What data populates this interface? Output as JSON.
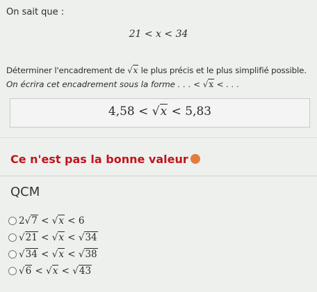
{
  "intro": "On sait que :",
  "given": "21 < x < 34",
  "question": {
    "before": "Déterminer l'encadrement de ",
    "sqrt_var": "x",
    "after": " le plus précis et le plus simplifié possible."
  },
  "hint": {
    "before": "On écrira cet encadrement sous la forme . . . < ",
    "sqrt_var": "x",
    "after": " < . . ."
  },
  "answer": {
    "left": "4,58 <",
    "sqrt_var": "x",
    "right": "< 5,83"
  },
  "feedback": {
    "text": "Ce n'est pas la bonne valeur",
    "icon": "sad-face-icon",
    "color": "#c1141b"
  },
  "qcm": {
    "title": "QCM",
    "options": [
      {
        "left_coef": "2",
        "left_rad": "7",
        "mid": "x",
        "right_text": "6",
        "right_rad": ""
      },
      {
        "left_coef": "",
        "left_rad": "21",
        "mid": "x",
        "right_text": "",
        "right_rad": "34"
      },
      {
        "left_coef": "",
        "left_rad": "34",
        "mid": "x",
        "right_text": "",
        "right_rad": "38"
      },
      {
        "left_coef": "",
        "left_rad": "6",
        "mid": "x",
        "right_text": "",
        "right_rad": "43"
      }
    ]
  }
}
